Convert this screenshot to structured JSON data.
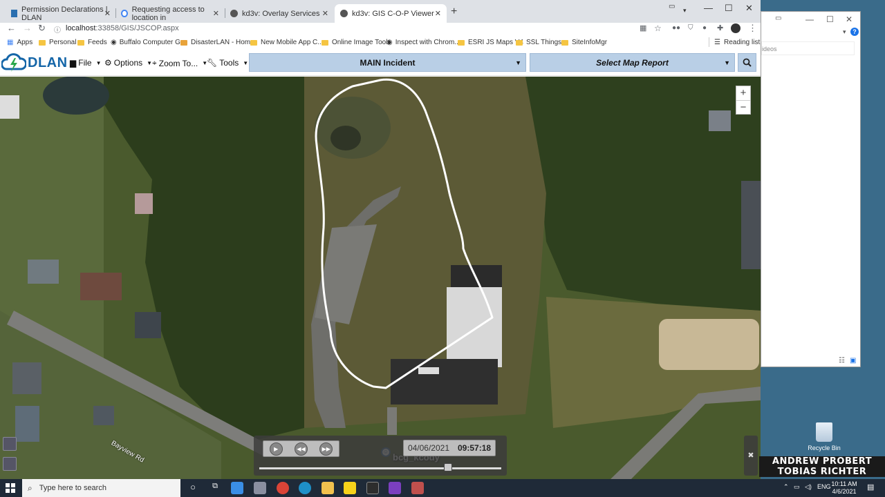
{
  "browser": {
    "tabs": [
      {
        "title": "Permission Declarations | DLAN"
      },
      {
        "title": "Requesting access to location in"
      },
      {
        "title": "kd3v: Overlay Services"
      },
      {
        "title": "kd3v: GIS C-O-P Viewer"
      }
    ],
    "url_host": "localhost",
    "url_path": ":33858/GIS/JSCOP.aspx",
    "bookmarks": [
      {
        "label": "Apps"
      },
      {
        "label": "Personal"
      },
      {
        "label": "Feeds"
      },
      {
        "label": "Buffalo Computer G..."
      },
      {
        "label": "DisasterLAN - Home"
      },
      {
        "label": "New Mobile App C..."
      },
      {
        "label": "Online Image Tools"
      },
      {
        "label": "Inspect with Chrom..."
      },
      {
        "label": "ESRI JS Maps V4"
      },
      {
        "label": "SSL Things"
      },
      {
        "label": "SiteInfoMgr"
      }
    ],
    "reading_list": "Reading list"
  },
  "app": {
    "logo_text": "DLAN",
    "menu": [
      {
        "label": "File",
        "icon": "folder-icon"
      },
      {
        "label": "Options",
        "icon": "gear-icon"
      },
      {
        "label": "Zoom To...",
        "icon": "crosshair-icon"
      },
      {
        "label": "Tools",
        "icon": "wrench-icon"
      }
    ],
    "incident_label": "MAIN Incident",
    "report_label": "Select Map Report"
  },
  "map": {
    "marker_label": "bcg_kcody",
    "road_label": "Bayview Rd",
    "zoom_in": "+",
    "zoom_out": "−"
  },
  "playback": {
    "date": "04/06/2021",
    "time": "09:57:18",
    "progress": 0.78
  },
  "desktop": {
    "side_field_text": "ideos",
    "recycle_label": "Recycle Bin",
    "credits": [
      "ANDREW PROBERT",
      "TOBIAS RICHTER"
    ]
  },
  "taskbar": {
    "search_placeholder": "Type here to search",
    "lang": "ENG",
    "clock_time": "10:11 AM",
    "clock_date": "4/6/2021"
  }
}
